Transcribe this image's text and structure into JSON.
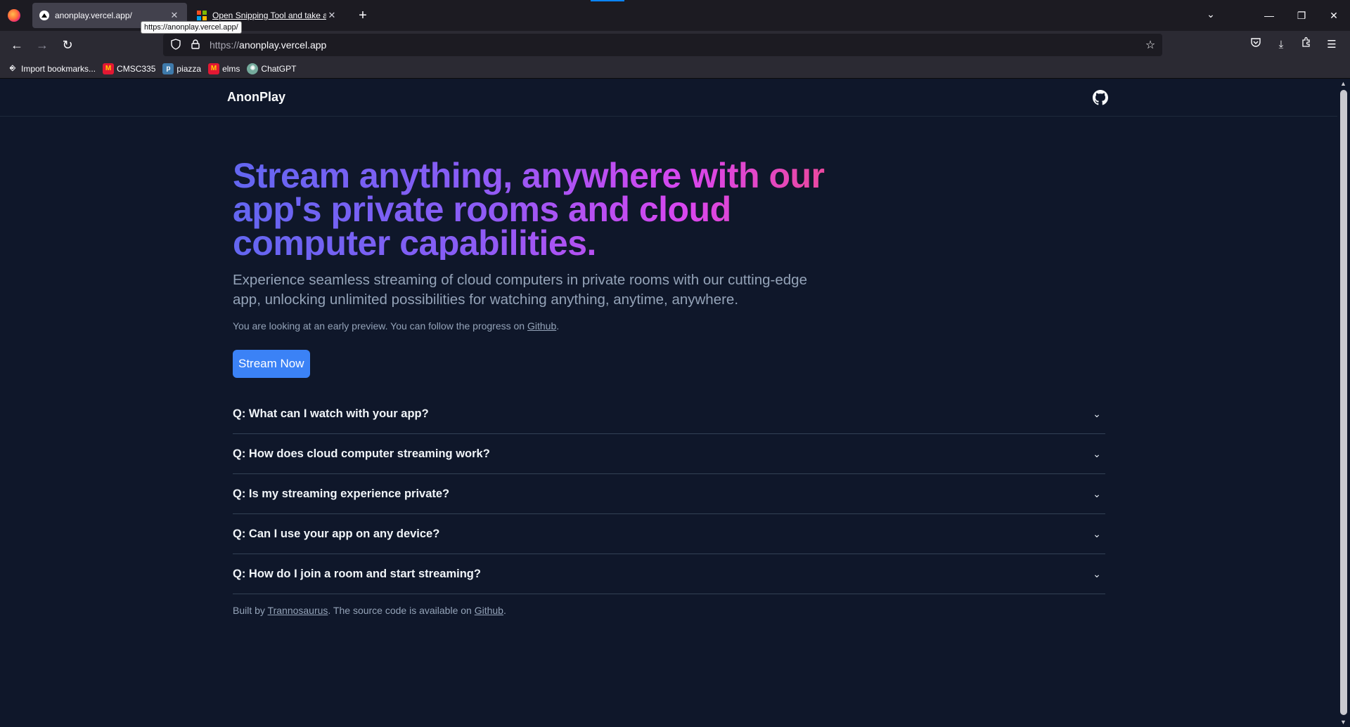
{
  "browser": {
    "tabs": [
      {
        "title": "anonplay.vercel.app/",
        "active": true
      },
      {
        "title": "Open Snipping Tool and take a",
        "active": false
      }
    ],
    "tooltip": "https://anonplay.vercel.app/",
    "url_protocol": "https://",
    "url_host": "anonplay.vercel.app",
    "bookmarks": [
      {
        "label": "Import bookmarks...",
        "icon": "import-icon"
      },
      {
        "label": "CMSC335",
        "icon": "umd-icon"
      },
      {
        "label": "piazza",
        "icon": "piazza-icon"
      },
      {
        "label": "elms",
        "icon": "umd-icon"
      },
      {
        "label": "ChatGPT",
        "icon": "chatgpt-icon"
      }
    ]
  },
  "site": {
    "brand": "AnonPlay",
    "hero_title": "Stream anything, anywhere with our app's private rooms and cloud computer capabilities.",
    "hero_subtitle": "Experience seamless streaming of cloud computers in private rooms with our cutting-edge app, unlocking unlimited possibilities for watching anything, anytime, anywhere.",
    "preview_prefix": "You are looking at an early preview. You can follow the progress on ",
    "preview_link": "Github",
    "preview_suffix": ".",
    "cta": "Stream Now",
    "faq": [
      "Q: What can I watch with your app?",
      "Q: How does cloud computer streaming work?",
      "Q: Is my streaming experience private?",
      "Q: Can I use your app on any device?",
      "Q: How do I join a room and start streaming?"
    ],
    "footer_prefix": "Built by ",
    "footer_author": "Trannosaurus",
    "footer_middle": ". The source code is available on ",
    "footer_link": "Github",
    "footer_suffix": "."
  },
  "colors": {
    "background": "#0f172a",
    "accent_button": "#3b82f6",
    "gradient": [
      "#6366f1",
      "#8b5cf6",
      "#d946ef",
      "#ec4899"
    ]
  }
}
